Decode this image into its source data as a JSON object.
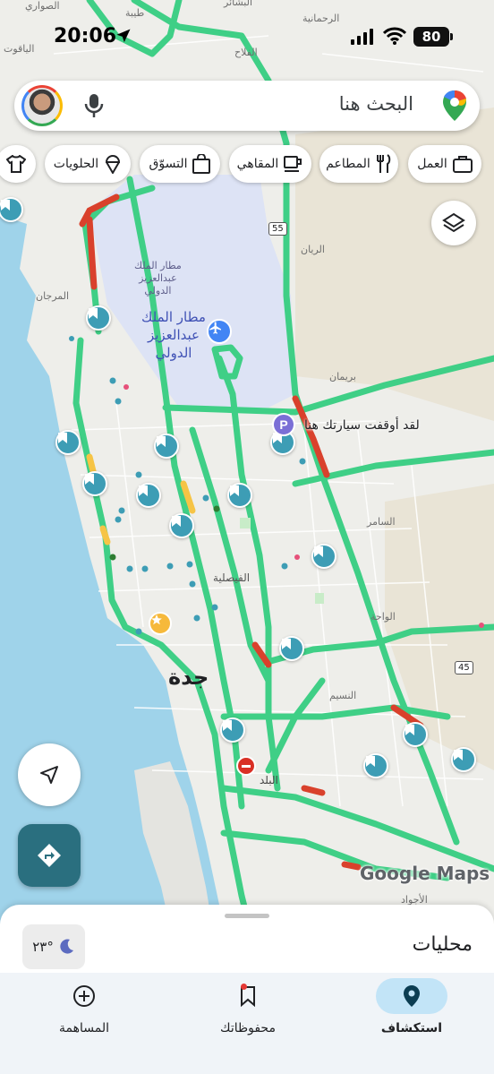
{
  "status_bar": {
    "time": "20:06",
    "battery": "80",
    "location_arrow_icon": "location-arrow-icon",
    "signal_icon": "cellular-signal-icon",
    "wifi_icon": "wifi-icon"
  },
  "search": {
    "placeholder": "البحث هنا",
    "mic_icon": "mic-icon",
    "logo_icon": "google-maps-pin-icon"
  },
  "chips": [
    {
      "label": "العمل",
      "icon": "briefcase-icon"
    },
    {
      "label": "المطاعم",
      "icon": "fork-knife-icon"
    },
    {
      "label": "المقاهي",
      "icon": "coffee-icon"
    },
    {
      "label": "التسوّق",
      "icon": "shopping-bag-icon"
    },
    {
      "label": "الحلويات",
      "icon": "ice-cream-icon"
    },
    {
      "label": "",
      "icon": "shirt-icon"
    }
  ],
  "map": {
    "airport_small": "مطار الملك عبدالعزيز الدولي",
    "airport_small_lines": [
      "مطار الملك",
      "عبدالعزيز",
      "الدولي"
    ],
    "airport_main_lines": [
      "مطار الملك",
      "عبدالعزيز",
      "الدولي"
    ],
    "city": "جدة",
    "parked_note": "لقد أوقفت سيارتك هنا",
    "watermark": "Google Maps",
    "highway_55": "55",
    "highway_45": "45",
    "districts": {
      "sawari": "الصواري",
      "tayba": "طيبة",
      "bashayer": "البشائر",
      "rahmaniya": "الرحمانية",
      "yaqout": "الياقوت",
      "falah": "الفلاح",
      "rayyan": "الريان",
      "murjan": "المرجان",
      "breiman": "بريمان",
      "samer": "السامر",
      "faisaliya": "الفيصلية",
      "waha": "الواحة",
      "naseem": "النسيم",
      "balad": "البلد",
      "ajwad": "الأجواد"
    },
    "colors": {
      "water": "#9fd3ea",
      "land": "#eeeeea",
      "airport": "#dde3f5",
      "traffic_green": "#3fcf86",
      "traffic_yellow": "#f6c445",
      "traffic_red": "#d9412c",
      "pin_teal": "#3d9db5"
    }
  },
  "controls": {
    "layers_icon": "layers-icon",
    "compass_icon": "navigation-arrow-icon",
    "directions_icon": "directions-icon"
  },
  "sheet": {
    "title": "محليات",
    "weather": "٢٣°",
    "weather_icon": "moon-icon"
  },
  "bottom_nav": [
    {
      "label": "استكشاف",
      "icon": "location-pin-icon",
      "active": true
    },
    {
      "label": "محفوظاتك",
      "icon": "bookmark-icon",
      "active": false
    },
    {
      "label": "المساهمة",
      "icon": "add-circle-icon",
      "active": false
    }
  ]
}
